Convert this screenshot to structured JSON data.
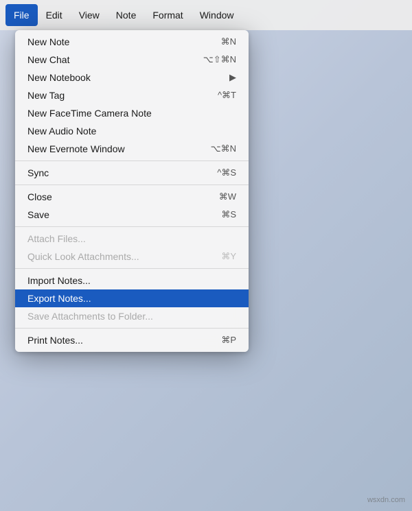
{
  "colors": {
    "active_menu": "#1a5bbf",
    "highlight": "#1a5bbf",
    "disabled": "#aaaaaa",
    "separator": "rgba(0,0,0,0.12)"
  },
  "menubar": {
    "items": [
      {
        "label": "File",
        "active": true
      },
      {
        "label": "Edit",
        "active": false
      },
      {
        "label": "View",
        "active": false
      },
      {
        "label": "Note",
        "active": false
      },
      {
        "label": "Format",
        "active": false
      },
      {
        "label": "Window",
        "active": false
      }
    ]
  },
  "dropdown": {
    "items": [
      {
        "id": "new-note",
        "label": "New Note",
        "shortcut": "⌘N",
        "disabled": false,
        "highlighted": false,
        "submenu": false,
        "separator_after": false
      },
      {
        "id": "new-chat",
        "label": "New Chat",
        "shortcut": "⌥⇧⌘N",
        "disabled": false,
        "highlighted": false,
        "submenu": false,
        "separator_after": false
      },
      {
        "id": "new-notebook",
        "label": "New Notebook",
        "shortcut": "▶",
        "disabled": false,
        "highlighted": false,
        "submenu": true,
        "separator_after": false
      },
      {
        "id": "new-tag",
        "label": "New Tag",
        "shortcut": "^⌘T",
        "disabled": false,
        "highlighted": false,
        "submenu": false,
        "separator_after": false
      },
      {
        "id": "new-facetime",
        "label": "New FaceTime Camera Note",
        "shortcut": "",
        "disabled": false,
        "highlighted": false,
        "submenu": false,
        "separator_after": false
      },
      {
        "id": "new-audio",
        "label": "New Audio Note",
        "shortcut": "",
        "disabled": false,
        "highlighted": false,
        "submenu": false,
        "separator_after": false
      },
      {
        "id": "new-evernote-window",
        "label": "New Evernote Window",
        "shortcut": "⌥⌘N",
        "disabled": false,
        "highlighted": false,
        "submenu": false,
        "separator_after": true
      },
      {
        "id": "sync",
        "label": "Sync",
        "shortcut": "^⌘S",
        "disabled": false,
        "highlighted": false,
        "submenu": false,
        "separator_after": true
      },
      {
        "id": "close",
        "label": "Close",
        "shortcut": "⌘W",
        "disabled": false,
        "highlighted": false,
        "submenu": false,
        "separator_after": false
      },
      {
        "id": "save",
        "label": "Save",
        "shortcut": "⌘S",
        "disabled": false,
        "highlighted": false,
        "submenu": false,
        "separator_after": true
      },
      {
        "id": "attach-files",
        "label": "Attach Files...",
        "shortcut": "",
        "disabled": true,
        "highlighted": false,
        "submenu": false,
        "separator_after": false
      },
      {
        "id": "quick-look",
        "label": "Quick Look Attachments...",
        "shortcut": "⌘Y",
        "disabled": true,
        "highlighted": false,
        "submenu": false,
        "separator_after": true
      },
      {
        "id": "import-notes",
        "label": "Import Notes...",
        "shortcut": "",
        "disabled": false,
        "highlighted": false,
        "submenu": false,
        "separator_after": false
      },
      {
        "id": "export-notes",
        "label": "Export Notes...",
        "shortcut": "",
        "disabled": false,
        "highlighted": true,
        "submenu": false,
        "separator_after": false
      },
      {
        "id": "save-attachments",
        "label": "Save Attachments to Folder...",
        "shortcut": "",
        "disabled": true,
        "highlighted": false,
        "submenu": false,
        "separator_after": true
      },
      {
        "id": "print-notes",
        "label": "Print Notes...",
        "shortcut": "⌘P",
        "disabled": false,
        "highlighted": false,
        "submenu": false,
        "separator_after": false
      }
    ]
  },
  "watermark": {
    "text": "wsxdn.com"
  }
}
